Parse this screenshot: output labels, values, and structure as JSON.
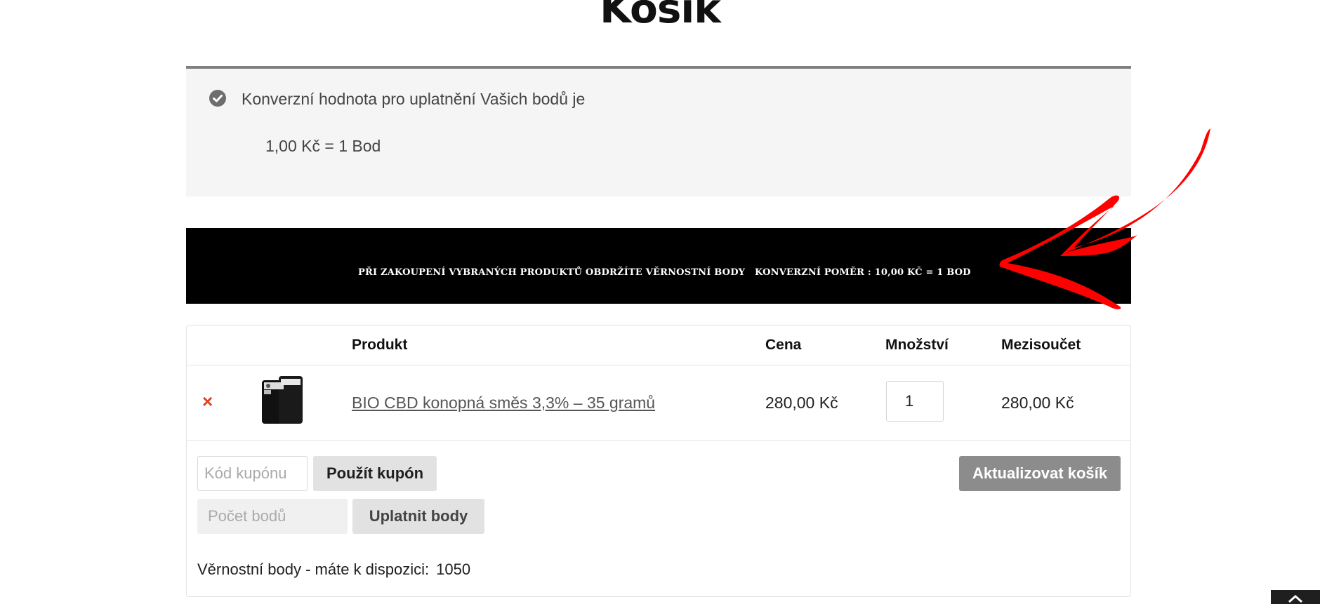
{
  "page": {
    "title": "Košík"
  },
  "notice": {
    "message": "Konverzní hodnota pro uplatnění Vašich bodů je",
    "rate": "1,00 Kč = 1 Bod"
  },
  "banner": {
    "text_left": "PŘI ZAKOUPENÍ VYBRANÝCH PRODUKTŮ OBDRŽÍTE VĚRNOSTNÍ BODY",
    "text_right": "KONVERZNÍ POMĚR : 10,00 KČ = 1 BOD"
  },
  "cart": {
    "headers": {
      "product": "Produkt",
      "price": "Cena",
      "quantity": "Množství",
      "subtotal": "Mezisoučet"
    },
    "items": [
      {
        "remove_icon": "×",
        "name": "BIO CBD konopná směs 3,3% – 35 gramů",
        "price": "280,00 Kč",
        "quantity": "1",
        "subtotal": "280,00 Kč"
      }
    ],
    "coupon_placeholder": "Kód kupónu",
    "apply_coupon_label": "Použít kupón",
    "points_placeholder": "Počet bodů",
    "apply_points_label": "Uplatnit body",
    "update_cart_label": "Aktualizovat košík",
    "loyalty_label": "Věrnostní body - máte k dispozici:",
    "loyalty_value": "1050"
  },
  "colors": {
    "remove": "#e2401c",
    "arrow": "#ff0000",
    "banner_bg": "#000000"
  },
  "icons": {
    "notice": "check-circle-icon",
    "scroll": "chevron-up-icon"
  }
}
